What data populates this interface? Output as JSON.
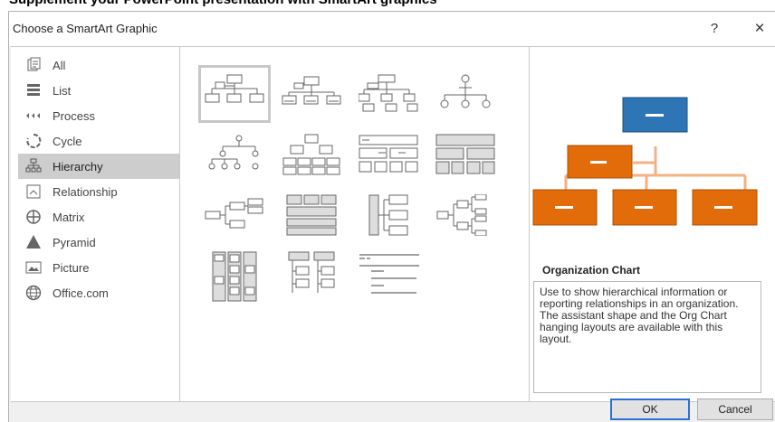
{
  "top_strip_text": "Supplement your PowerPoint presentation with SmartArt graphics",
  "dialog": {
    "title": "Choose a SmartArt Graphic",
    "help_label": "?",
    "close_label": "×"
  },
  "categories": [
    {
      "label": "All",
      "icon": "all-icon"
    },
    {
      "label": "List",
      "icon": "list-icon"
    },
    {
      "label": "Process",
      "icon": "process-icon"
    },
    {
      "label": "Cycle",
      "icon": "cycle-icon"
    },
    {
      "label": "Hierarchy",
      "icon": "hierarchy-icon",
      "selected": true
    },
    {
      "label": "Relationship",
      "icon": "relationship-icon"
    },
    {
      "label": "Matrix",
      "icon": "matrix-icon"
    },
    {
      "label": "Pyramid",
      "icon": "pyramid-icon"
    },
    {
      "label": "Picture",
      "icon": "picture-icon"
    },
    {
      "label": "Office.com",
      "icon": "globe-icon"
    }
  ],
  "gallery": {
    "selected_index": 0,
    "count": 15
  },
  "preview": {
    "title": "Organization Chart",
    "description": "Use to show hierarchical information or reporting relationships in an organization. The assistant shape and the Org Chart hanging layouts are available with this layout.",
    "colors": {
      "top": "#2e75b6",
      "children": "#e36c0a",
      "line": "#f4b183"
    }
  },
  "buttons": {
    "ok": "OK",
    "cancel": "Cancel"
  }
}
